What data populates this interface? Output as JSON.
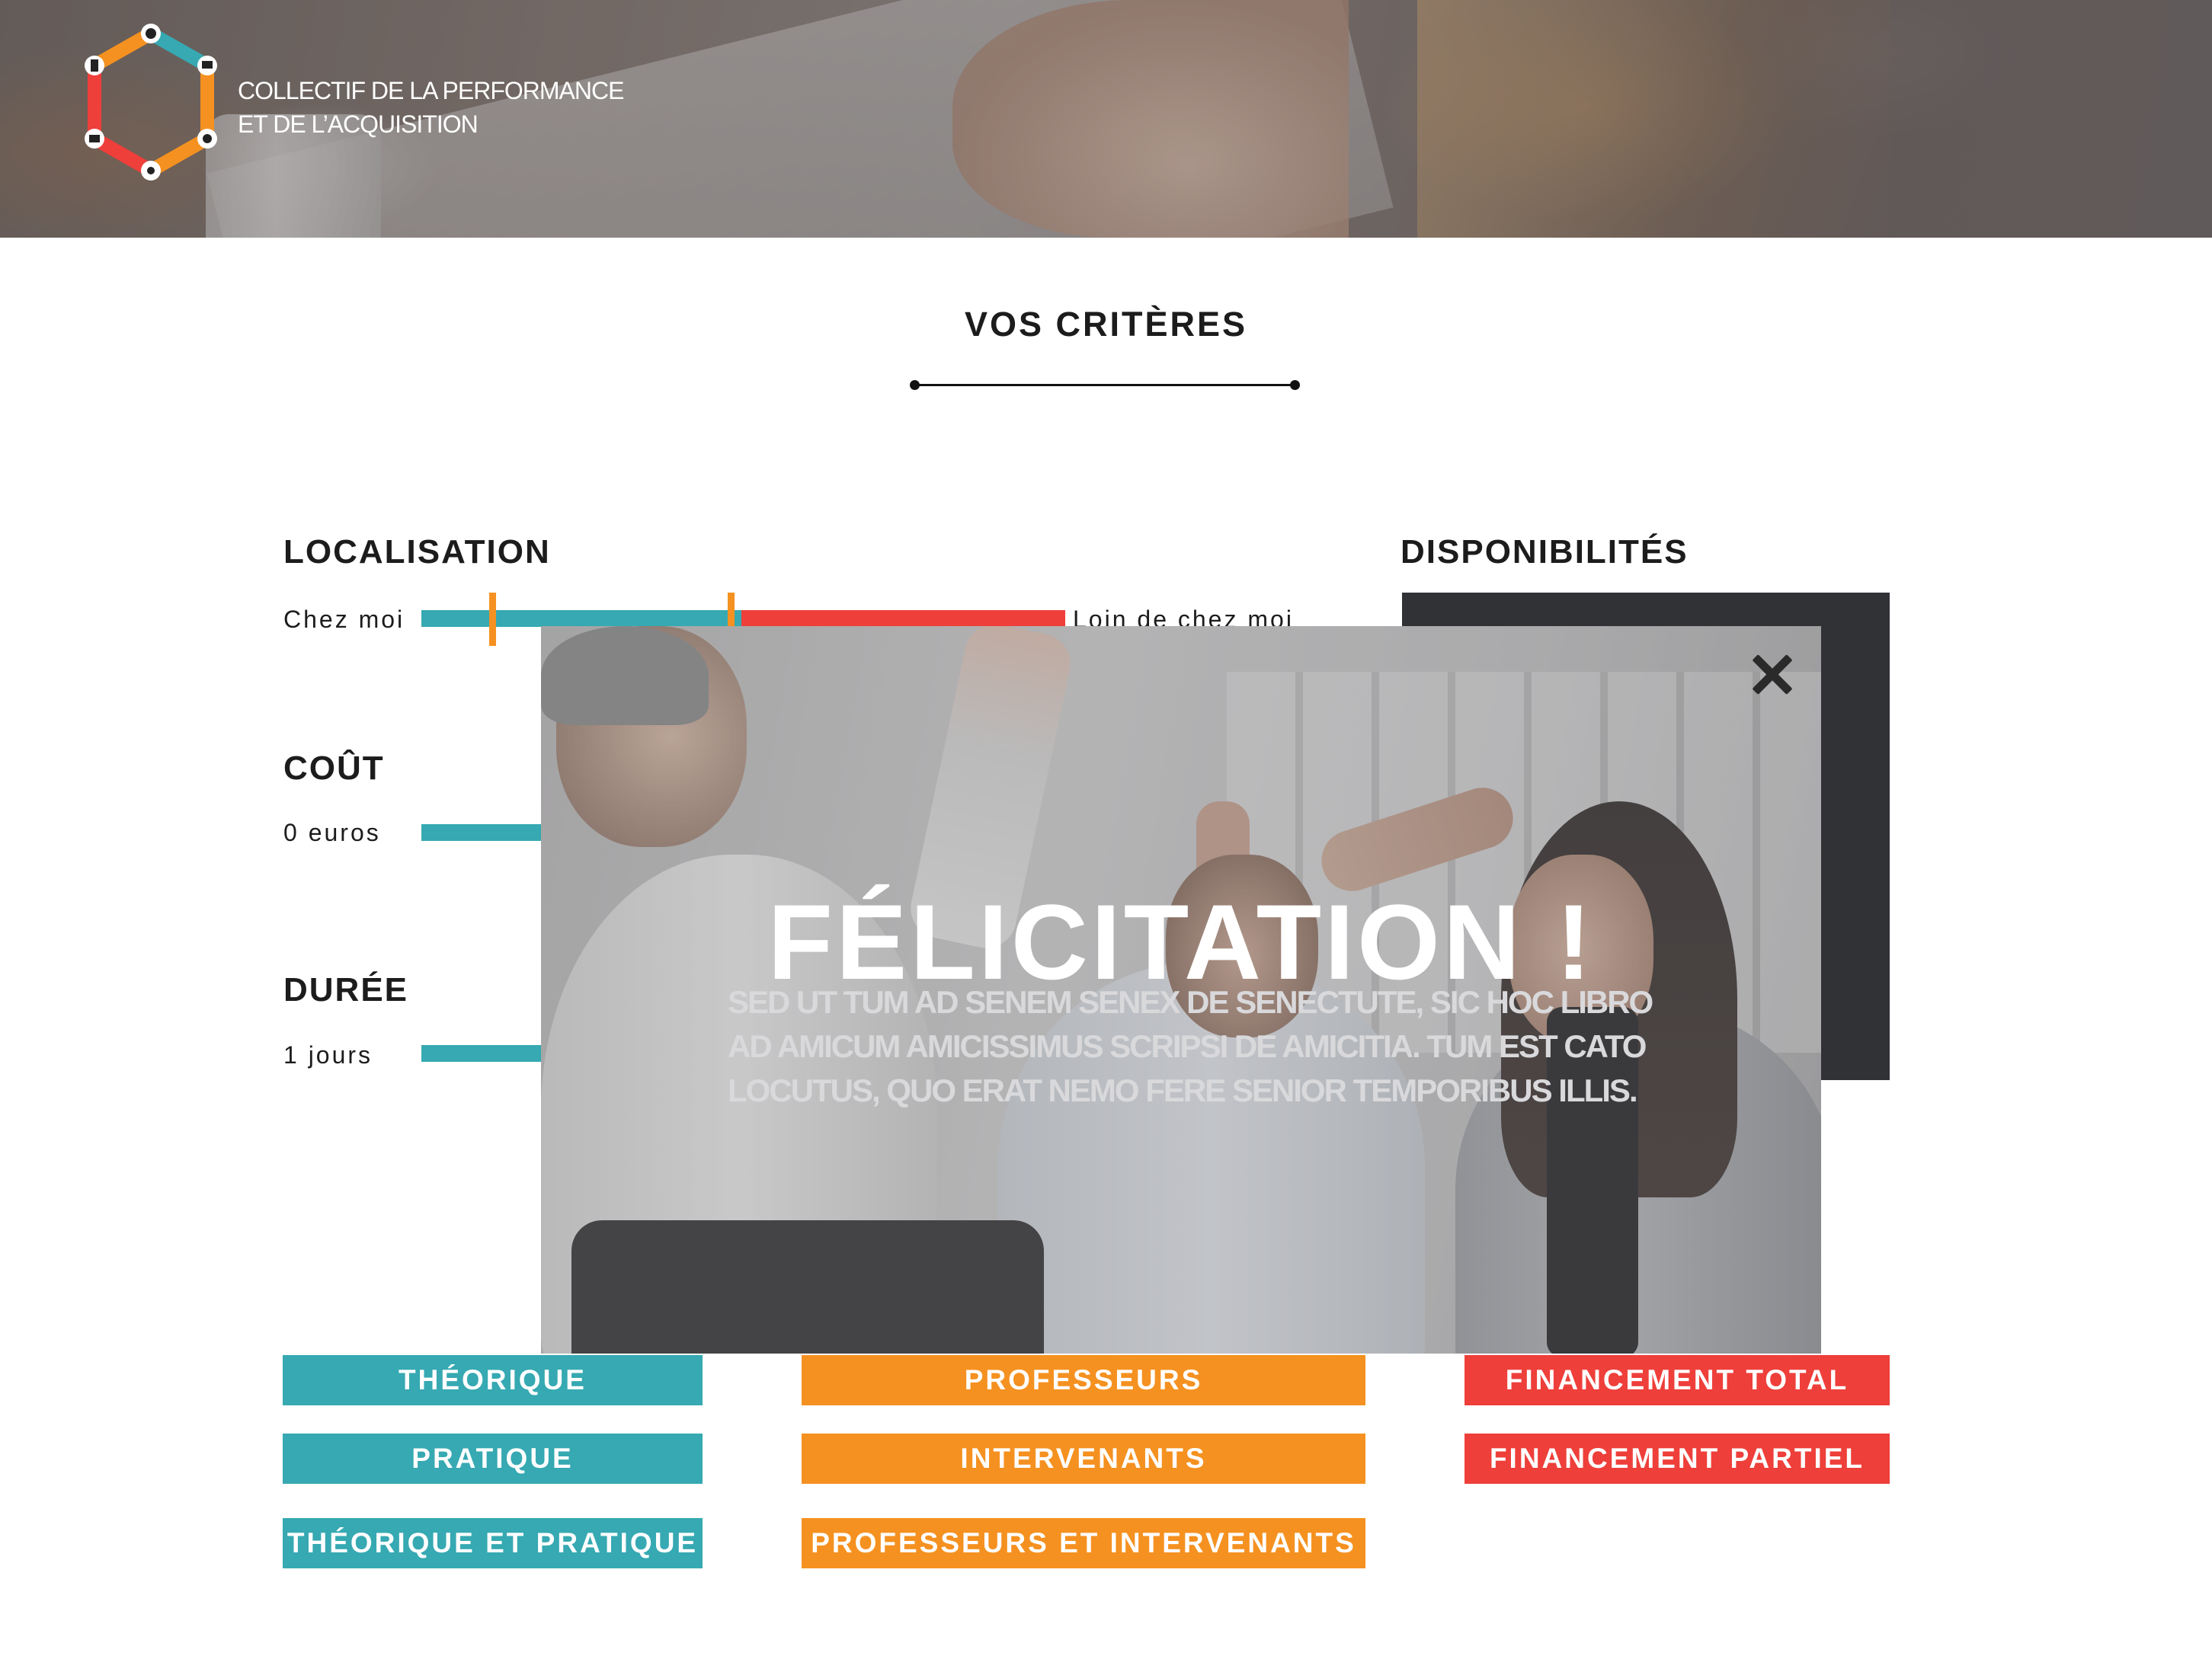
{
  "header": {
    "brand_line1": "COLLECTIF DE LA PERFORMANCE",
    "brand_line2": "ET DE L’ACQUISITION"
  },
  "section": {
    "title": "VOS CRITÈRES"
  },
  "criteria": {
    "localisation": {
      "label": "LOCALISATION",
      "min_label": "Chez moi",
      "max_label": "Loin de chez moi"
    },
    "disponibilites": {
      "label": "DISPONIBILITÉS"
    },
    "cout": {
      "label": "COÛT",
      "min_label": "0 euros"
    },
    "duree": {
      "label": "DURÉE",
      "min_label": "1 jours"
    }
  },
  "tags": {
    "type": [
      "THÉORIQUE",
      "PRATIQUE",
      "THÉORIQUE ET PRATIQUE"
    ],
    "encadrement": [
      "PROFESSEURS",
      "INTERVENANTS",
      "PROFESSEURS ET INTERVENANTS"
    ],
    "financement": [
      "FINANCEMENT TOTAL",
      "FINANCEMENT PARTIEL"
    ]
  },
  "modal": {
    "title": "FÉLICITATION !",
    "text_line1": "SED UT TUM AD SENEM SENEX DE SENECTUTE, SIC HOC LIBRO",
    "text_line2": "AD AMICUM AMICISSIMUS SCRIPSI DE AMICITIA. TUM EST CATO",
    "text_line3": "LOCUTUS, QUO ERAT NEMO FERE SENIOR TEMPORIBUS ILLIS."
  },
  "colors": {
    "teal": "#36a9b2",
    "orange": "#f59120",
    "red": "#ee3f3a",
    "dark": "#313236"
  },
  "icons": [
    "close-icon",
    "logo-hexagon-icon"
  ]
}
